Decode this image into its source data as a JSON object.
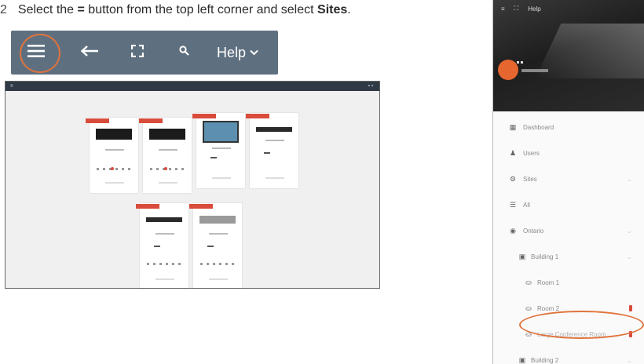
{
  "instruction": {
    "step": "2",
    "text_before": "Select the ",
    "symbol": "=",
    "text_middle": " button from the top left corner and select ",
    "target": "Sites",
    "text_after": "."
  },
  "toolbar": {
    "background": "#5e7080",
    "highlight_color": "#e0733b",
    "help_label": "Help",
    "icons": [
      "hamburger-menu-icon",
      "back-arrow-icon",
      "fullscreen-icon",
      "search-icon",
      "chevron-down-icon"
    ]
  },
  "room_view": {
    "title": "",
    "card_count": 6
  },
  "side_panel": {
    "header_top": "Help",
    "nav": [
      {
        "label": "Dashboard",
        "icon": "dashboard-icon"
      },
      {
        "label": "Users",
        "icon": "users-icon"
      },
      {
        "label": "Sites",
        "icon": "sites-icon"
      },
      {
        "label": "All",
        "icon": "list-icon"
      },
      {
        "label": "Ontario",
        "icon": "location-icon"
      },
      {
        "label": "Building 1",
        "icon": "building-icon"
      },
      {
        "label": "Room 1",
        "icon": "room-icon"
      },
      {
        "label": "Room 2",
        "icon": "room-icon"
      },
      {
        "label": "Large Conference Room",
        "icon": "room-icon"
      },
      {
        "label": "Building 2",
        "icon": "building-icon"
      }
    ]
  }
}
